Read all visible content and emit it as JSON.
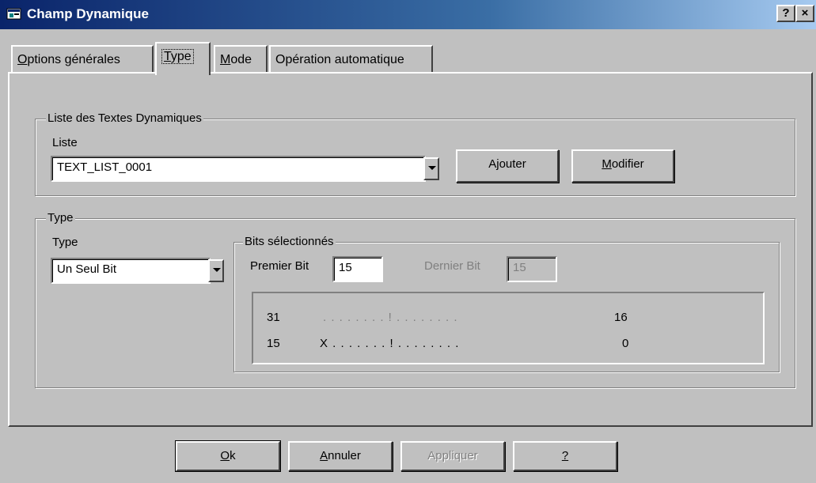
{
  "window": {
    "title": "Champ Dynamique",
    "help_button": "?",
    "close_button": "×"
  },
  "tabs": [
    {
      "label": "Options générales",
      "mnemonic": "O",
      "active": false
    },
    {
      "label": "Type",
      "mnemonic": "T",
      "active": true
    },
    {
      "label": "Mode",
      "mnemonic": "M",
      "active": false
    },
    {
      "label": "Opération automatique",
      "mnemonic": "",
      "active": false
    }
  ],
  "dynamic_text_list": {
    "group_label": "Liste des Textes Dynamiques",
    "list_label": "Liste",
    "list_value": "TEXT_LIST_0001",
    "add_button": "Ajouter",
    "modify_button": "Modifier"
  },
  "type_group": {
    "group_label": "Type",
    "type_label": "Type",
    "type_value": "Un Seul Bit",
    "bits": {
      "group_label": "Bits sélectionnés",
      "first_bit_label": "Premier Bit",
      "first_bit_value": "15",
      "last_bit_label": "Dernier Bit",
      "last_bit_value": "15",
      "row1_start": "31",
      "row1_marks": ". . . . . . . . ! . . . . . . . .",
      "row1_end": "16",
      "row2_start": "15",
      "row2_marks": "X . . . . . . . ! . . . . . . . .",
      "row2_end": "0"
    }
  },
  "footer": {
    "ok": "Ok",
    "cancel": "Annuler",
    "apply": "Appliquer",
    "help": "?"
  }
}
